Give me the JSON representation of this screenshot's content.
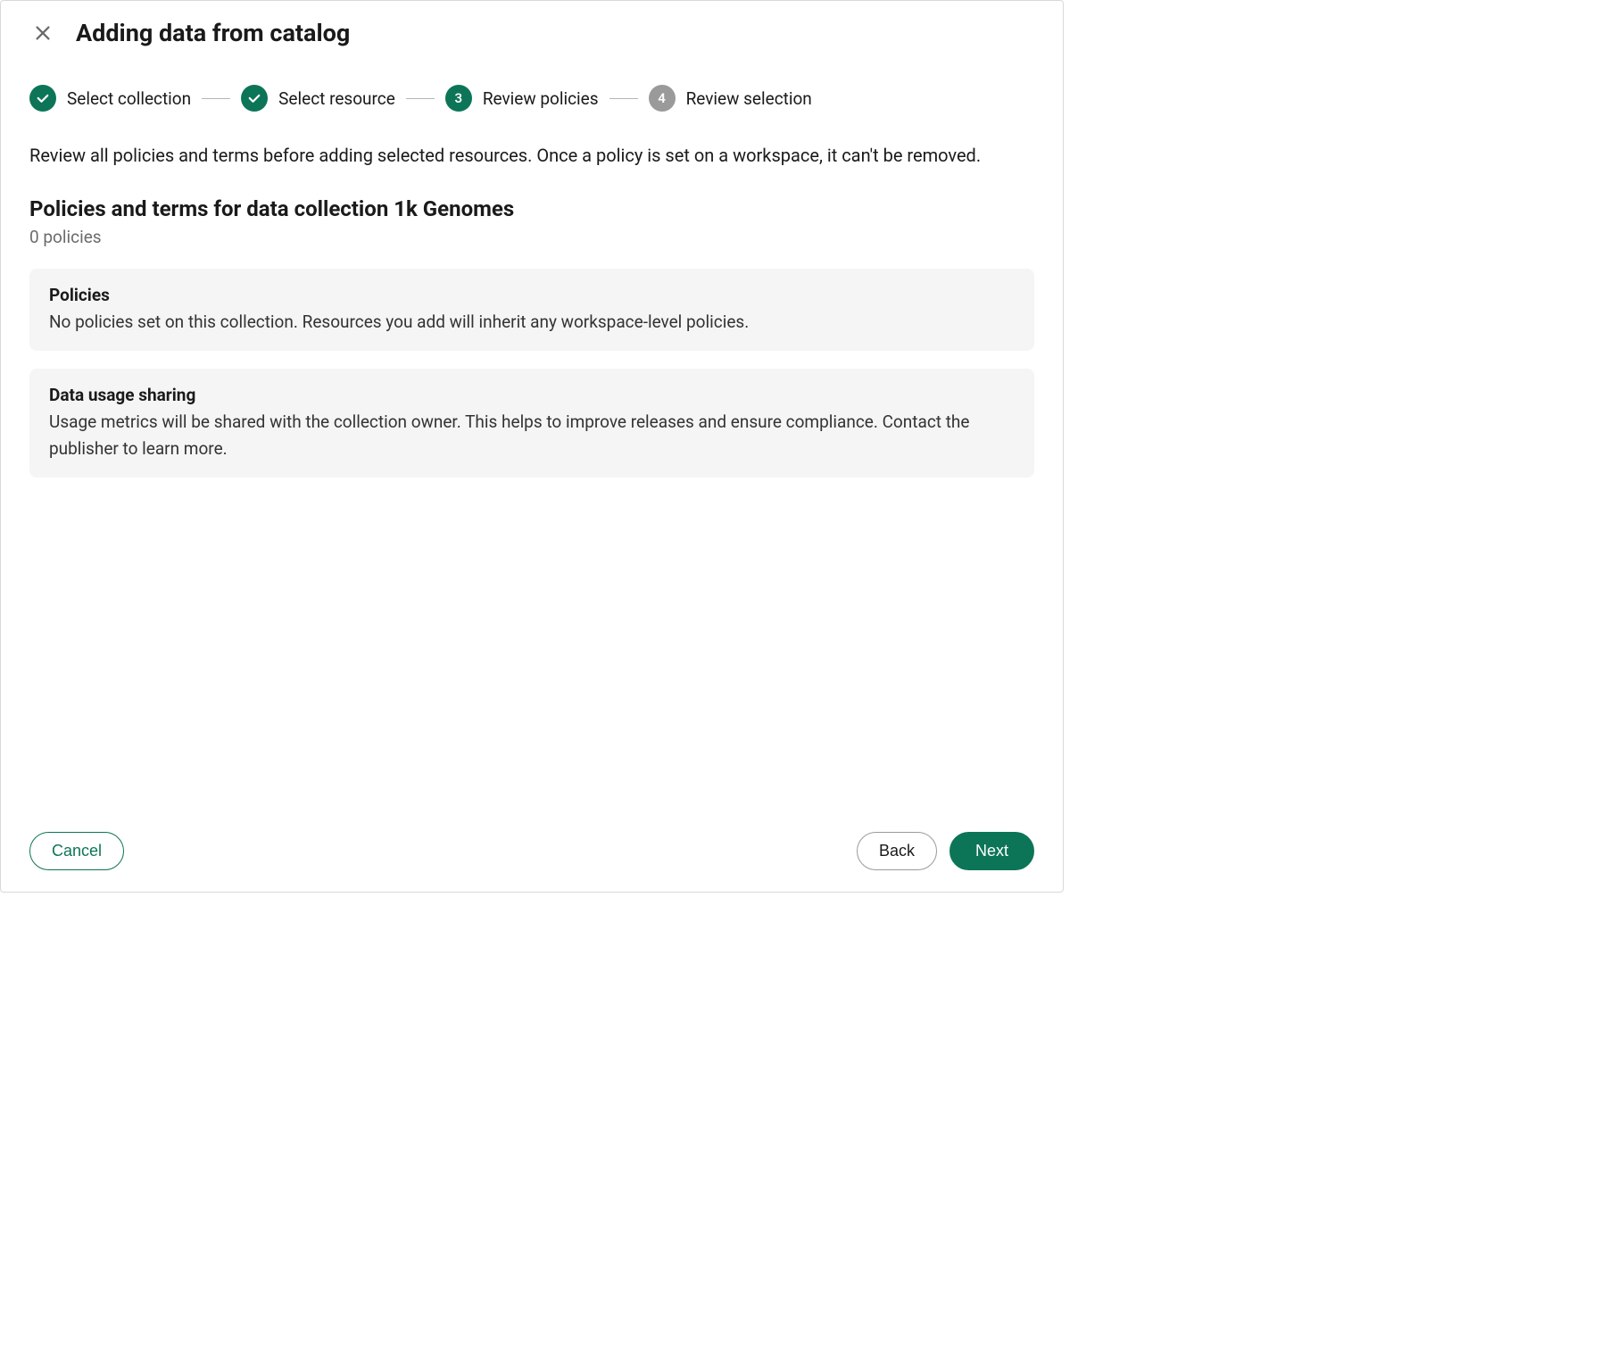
{
  "header": {
    "title": "Adding data from catalog"
  },
  "stepper": {
    "steps": [
      {
        "label": "Select collection",
        "state": "done"
      },
      {
        "label": "Select resource",
        "state": "done"
      },
      {
        "label": "Review policies",
        "state": "active",
        "number": "3"
      },
      {
        "label": "Review selection",
        "state": "pending",
        "number": "4"
      }
    ]
  },
  "body": {
    "intro": "Review all policies and terms before adding selected resources. Once a policy is set on a workspace, it can't be removed.",
    "section_title": "Policies and terms for data collection 1k Genomes",
    "policy_count": "0 policies",
    "cards": [
      {
        "title": "Policies",
        "text": "No policies set on this collection. Resources you add will inherit any workspace-level policies."
      },
      {
        "title": "Data usage sharing",
        "text": "Usage metrics will be shared with the collection owner. This helps to improve releases and ensure compliance. Contact the publisher to learn more."
      }
    ]
  },
  "footer": {
    "cancel": "Cancel",
    "back": "Back",
    "next": "Next"
  }
}
